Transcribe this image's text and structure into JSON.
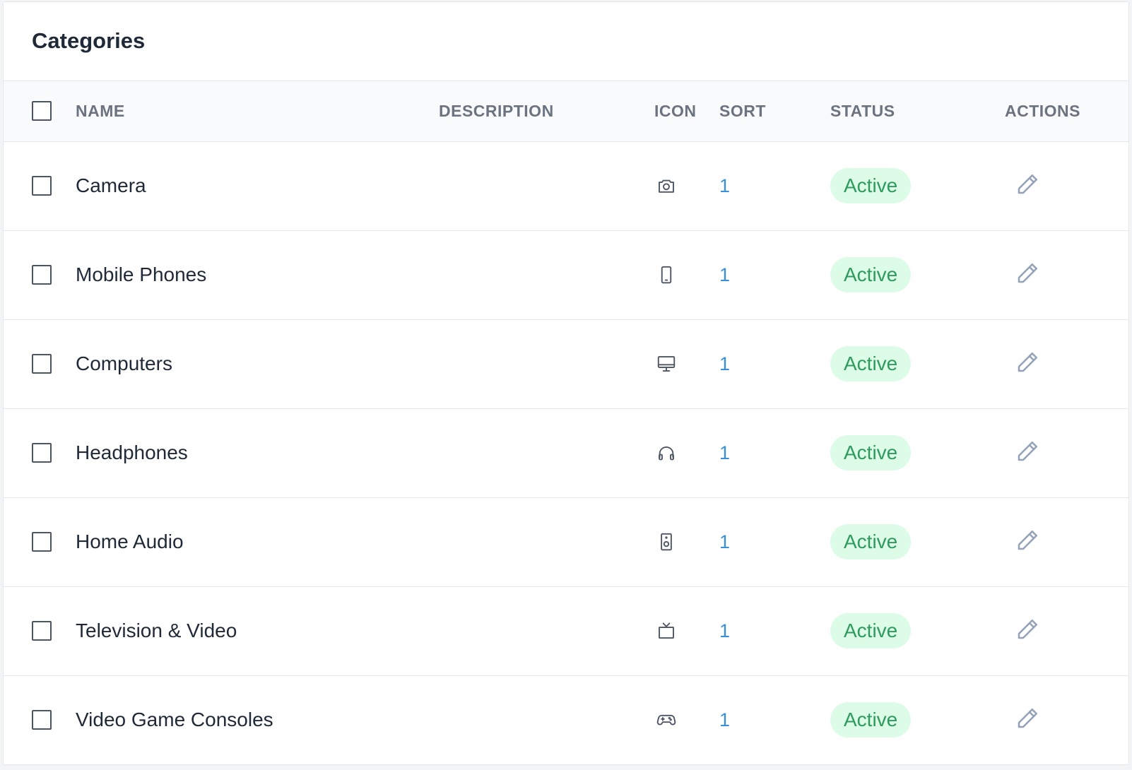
{
  "card": {
    "title": "Categories"
  },
  "table": {
    "headers": {
      "name": "NAME",
      "description": "DESCRIPTION",
      "icon": "ICON",
      "sort": "SORT",
      "status": "STATUS",
      "actions": "ACTIONS"
    },
    "rows": [
      {
        "name": "Camera",
        "description": "",
        "icon": "camera-icon",
        "sort": "1",
        "status": "Active"
      },
      {
        "name": "Mobile Phones",
        "description": "",
        "icon": "mobile-phone-icon",
        "sort": "1",
        "status": "Active"
      },
      {
        "name": "Computers",
        "description": "",
        "icon": "desktop-computer-icon",
        "sort": "1",
        "status": "Active"
      },
      {
        "name": "Headphones",
        "description": "",
        "icon": "headphones-icon",
        "sort": "1",
        "status": "Active"
      },
      {
        "name": "Home Audio",
        "description": "",
        "icon": "speaker-icon",
        "sort": "1",
        "status": "Active"
      },
      {
        "name": "Television & Video",
        "description": "",
        "icon": "television-icon",
        "sort": "1",
        "status": "Active"
      },
      {
        "name": "Video Game Consoles",
        "description": "",
        "icon": "gamepad-icon",
        "sort": "1",
        "status": "Active"
      }
    ]
  },
  "colors": {
    "status_active_bg": "#dcfce7",
    "status_active_text": "#2f9a5e",
    "sort_link": "#3b8fd9",
    "edit_icon": "#9ca3af"
  }
}
